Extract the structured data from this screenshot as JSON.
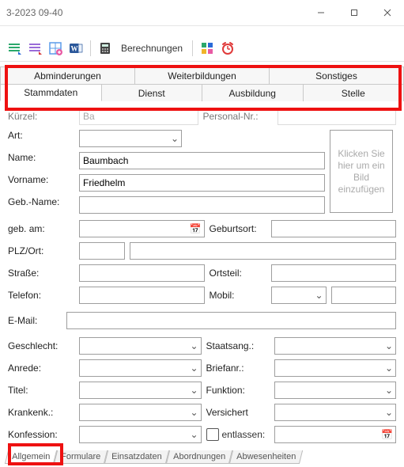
{
  "window": {
    "title": "3-2023 09-40"
  },
  "toolbar": {
    "calc_label": "Berechnungen"
  },
  "tabs_upper": {
    "row1": [
      "Abminderungen",
      "Weiterbildungen",
      "Sonstiges"
    ],
    "row2": [
      "Stammdaten",
      "Dienst",
      "Ausbildung",
      "Stelle"
    ]
  },
  "labels": {
    "kuerzel": "Kürzel:",
    "personalnr": "Personal-Nr.:",
    "art": "Art:",
    "name": "Name:",
    "vorname": "Vorname:",
    "gebname": "Geb.-Name:",
    "gebam": "geb. am:",
    "geburtsort": "Geburtsort:",
    "plzort": "PLZ/Ort:",
    "strasse": "Straße:",
    "ortsteil": "Ortsteil:",
    "telefon": "Telefon:",
    "mobil": "Mobil:",
    "email": "E-Mail:",
    "geschlecht": "Geschlecht:",
    "staatsang": "Staatsang.:",
    "anrede": "Anrede:",
    "briefanr": "Briefanr.:",
    "titel": "Titel:",
    "funktion": "Funktion:",
    "krankenk": "Krankenk.:",
    "versichert": "Versichert",
    "konfession": "Konfession:",
    "entlassen": "entlassen:"
  },
  "values": {
    "kuerzel": "Ba",
    "personalnr": "",
    "art": "",
    "name": "Baumbach",
    "vorname": "Friedhelm",
    "gebname": "",
    "gebam": "",
    "geburtsort": "",
    "plz": "",
    "ort": "",
    "strasse": "",
    "ortsteil": "",
    "telefon": "",
    "mobil_prefix": "",
    "mobil": "",
    "email": "",
    "geschlecht": "",
    "staatsang": "",
    "anrede": "",
    "briefanr": "",
    "titel": "",
    "funktion": "",
    "krankenk": "",
    "versichert": "",
    "konfession": "",
    "entlassen_checked": false,
    "entlassen_date": ""
  },
  "photo_placeholder": "Klicken Sie hier um ein Bild einzufügen",
  "bottom_tabs": [
    "Allgemein",
    "Formulare",
    "Einsatzdaten",
    "Abordnungen",
    "Abwesenheiten"
  ]
}
